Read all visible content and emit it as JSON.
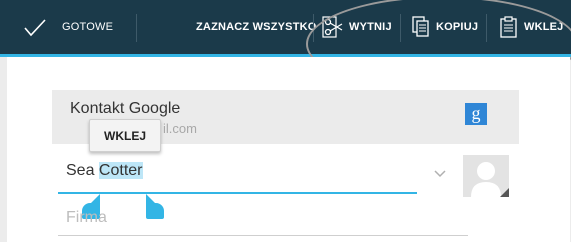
{
  "actionbar": {
    "done_label": "GOTOWE",
    "select_all_label": "ZAZNACZ WSZYSTKO",
    "cut_label": "WYTNIJ",
    "copy_label": "KOPIUJ",
    "paste_label": "WKLEJ",
    "icons": [
      "check-icon",
      "scissors-icon",
      "copy-icon",
      "clipboard-icon"
    ],
    "accent": "#33b5e5",
    "background": "#1b3a4a"
  },
  "account": {
    "title": "Kontakt Google",
    "subtitle": "il.com",
    "logo_text": "g"
  },
  "popup": {
    "label": "WKLEJ"
  },
  "name_field": {
    "value_before": "Sea ",
    "value_selected": "Cotter"
  },
  "company_field": {
    "placeholder": "Firma"
  },
  "colors": {
    "selection": "#bde6f7",
    "google_blue": "#2f86d6"
  }
}
